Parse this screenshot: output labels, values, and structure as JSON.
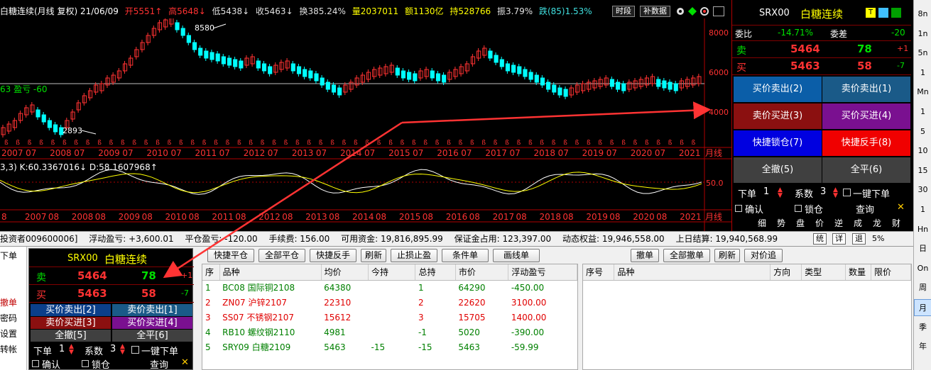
{
  "chart_header": {
    "title": "白糖连续(月线 复权) 21/06/09",
    "open": "开5551↑",
    "high": "高5648↓",
    "low": "低5438↓",
    "close": "收5463↓",
    "turnover": "换385.24%",
    "volume": "量2037011",
    "amount": "额1130亿",
    "position": "持528766",
    "amplitude": "振3.79%",
    "change": "跌(85)1.53%",
    "btn_timeshare": "时段",
    "btn_fill_data": "补数据"
  },
  "chart_annotations": {
    "high_label": "8580",
    "low_label": "2893",
    "pnl_label": "63 盈亏 -60",
    "kd_label": "3,3) K:60.3367016↓ D:58.1607968↑",
    "period_label": "月线",
    "kd_level": "50.0",
    "axis_prices": [
      "8000",
      "6000",
      "4000"
    ]
  },
  "x_axis_labels": [
    "2007",
    "07",
    "2008",
    "07",
    "2009",
    "07",
    "2010",
    "07",
    "2011",
    "07",
    "2012",
    "07",
    "2013",
    "07",
    "2014",
    "07",
    "2015",
    "07",
    "2016",
    "07",
    "2017",
    "07",
    "2018",
    "07",
    "2019",
    "07",
    "2020",
    "07",
    "2021"
  ],
  "x_axis_labels_lower": [
    "8",
    "2007",
    "08",
    "2008",
    "08",
    "2009",
    "08",
    "2010",
    "08",
    "2011",
    "08",
    "2012",
    "08",
    "2013",
    "08",
    "2014",
    "08",
    "2015",
    "08",
    "2016",
    "08",
    "2017",
    "08",
    "2018",
    "08",
    "2019",
    "08",
    "2020",
    "08",
    "2021"
  ],
  "quote_panel": {
    "code": "SRX00",
    "name": "白糖连续",
    "weibi_label": "委比",
    "weibi_value": "-14.71%",
    "weicha_label": "委差",
    "weicha_value": "-20",
    "sell_label": "卖",
    "sell_price": "5464",
    "sell_qty": "78",
    "sell_change": "+1",
    "buy_label": "买",
    "buy_price": "5463",
    "buy_qty": "58",
    "buy_change": "-7",
    "btn_buyprice_sell": "买价卖出(2)",
    "btn_sellprice_sell": "卖价卖出(1)",
    "btn_sellprice_buy": "卖价买进(3)",
    "btn_buyprice_buy": "买价买进(4)",
    "btn_quick_lock": "快捷锁仓(7)",
    "btn_quick_reverse": "快捷反手(8)",
    "btn_cancel_all": "全撤(5)",
    "btn_close_all": "全平(6)",
    "order_qty_label": "下单",
    "order_qty_value": "1",
    "multiplier_label": "系数",
    "multiplier_value": "3",
    "one_click_label": "一键下单",
    "confirm_label": "确认",
    "lock_label": "锁仓",
    "query_label": "查询",
    "tabs": [
      "细",
      "势",
      "盘",
      "价",
      "逆",
      "成",
      "龙",
      "财"
    ]
  },
  "side_bar_items": [
    "8n",
    "1n",
    "5n",
    "1",
    "Mn",
    "1",
    "5",
    "10",
    "15",
    "30",
    "1",
    "Hn",
    "日",
    "On",
    "周",
    "月",
    "季",
    "年"
  ],
  "status_bar": {
    "account": "投资者009600006]",
    "float_pnl": "浮动盈亏: +3,600.01",
    "close_pnl": "平仓盈亏: -120.00",
    "fee": "手续费: 156.00",
    "available": "可用资金: 19,816,895.99",
    "margin": "保证金占用: 123,397.00",
    "dynamic_equity": "动态权益: 19,946,558.00",
    "last_settle": "上日结算: 19,940,568.99",
    "btn_stats": "统",
    "btn_detail": "详",
    "btn_back": "退",
    "pct": "5%"
  },
  "left_panel": {
    "menu_items": [
      "下单",
      "",
      "",
      "撤单",
      "密码",
      "设置",
      "转帐"
    ],
    "code": "SRX00",
    "name": "白糖连续",
    "sell_label": "卖",
    "sell_price": "5464",
    "sell_qty": "78",
    "sell_change": "+1",
    "buy_label": "买",
    "buy_price": "5463",
    "buy_qty": "58",
    "buy_change": "-7",
    "btn_buyprice_sell": "买价卖出[2]",
    "btn_sellprice_sell": "卖价卖出[1]",
    "btn_sellprice_buy": "卖价买进[3]",
    "btn_buyprice_buy": "买价买进[4]",
    "btn_cancel_all": "全撤[5]",
    "btn_close_all": "全平[6]",
    "order_qty_label": "下单",
    "order_qty_value": "1",
    "multiplier_label": "系数",
    "multiplier_value": "3",
    "one_click_label": "一键下单",
    "confirm_label": "确认",
    "lock_label": "锁仓",
    "query_label": "查询"
  },
  "position_toolbar": [
    "快捷平仓",
    "全部平仓",
    "快捷反手",
    "刷新",
    "止损止盈",
    "条件单",
    "画线单"
  ],
  "position_table": {
    "headers": [
      "序",
      "品种",
      "均价",
      "今持",
      "总持",
      "市价",
      "浮动盈亏"
    ],
    "rows": [
      {
        "cells": [
          "1",
          "BC08 国际铜2108",
          "64380",
          "",
          "1",
          "64290",
          "-450.00"
        ],
        "color": "#008000"
      },
      {
        "cells": [
          "2",
          "ZN07 沪锌2107",
          "22310",
          "",
          "2",
          "22620",
          "3100.00"
        ],
        "color": "#e00000"
      },
      {
        "cells": [
          "3",
          "SS07 不锈钢2107",
          "15612",
          "",
          "3",
          "15705",
          "1400.00"
        ],
        "color": "#e00000"
      },
      {
        "cells": [
          "4",
          "RB10 螺纹钢2110",
          "4981",
          "",
          "-1",
          "5020",
          "-390.00"
        ],
        "color": "#008000"
      },
      {
        "cells": [
          "5",
          "SRY09 白糖2109",
          "5463",
          "-15",
          "-15",
          "5463",
          "-59.99"
        ],
        "color": "#008000"
      }
    ]
  },
  "order_toolbar": [
    "撤单",
    "全部撤单",
    "刷新",
    "对价追"
  ],
  "order_table": {
    "headers": [
      "序号",
      "品种",
      "方向",
      "类型",
      "数量",
      "限价"
    ]
  },
  "colors": {
    "rise": "#ff3232",
    "fall": "#00ffff",
    "grid": "#b00000",
    "arrow": "#ff3333"
  }
}
